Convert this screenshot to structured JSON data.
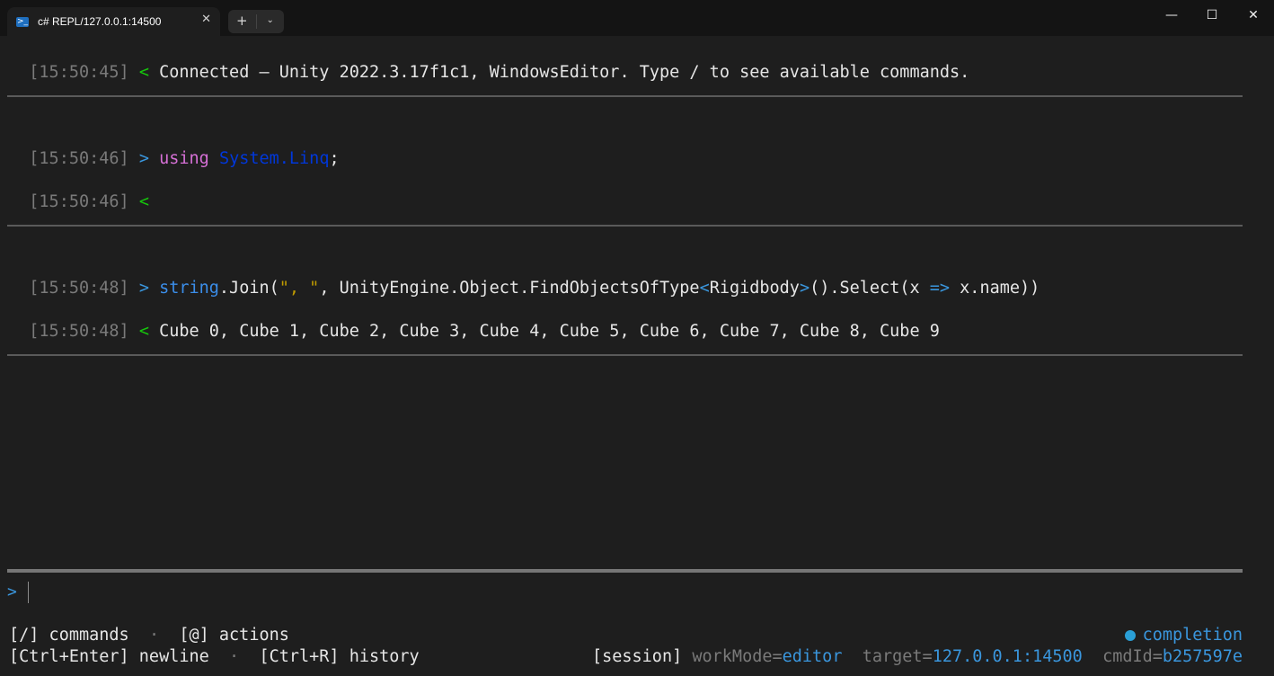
{
  "window": {
    "tab_title": "c# REPL/127.0.0.1:14500",
    "tab_icon": "powershell-icon",
    "new_tab_label": "+",
    "dropdown_label": "⌄",
    "close_tab_label": "✕",
    "minimize_label": "—",
    "maximize_label": "☐",
    "close_label": "✕"
  },
  "console": {
    "connected": {
      "ts": "[15:50:45]",
      "dir": "<",
      "text": "Connected — Unity 2022.3.17f1c1, WindowsEditor. Type / to see available commands."
    },
    "cmd1": {
      "ts": "[15:50:46]",
      "dir": ">",
      "kw": "using",
      "ns": "System.Linq",
      "semi": ";"
    },
    "out1": {
      "ts": "[15:50:46]",
      "dir": "<",
      "text": ""
    },
    "cmd2": {
      "ts": "[15:50:48]",
      "dir": ">",
      "t1": "string",
      "t2": ".Join(",
      "t3": "\", \"",
      "t4": ", UnityEngine.Object.FindObjectsOfType",
      "t5": "<",
      "t6": "Rigidbody",
      "t7": ">",
      "t8": "().Select(x ",
      "t9": "=>",
      "t10": " x.name))"
    },
    "out2": {
      "ts": "[15:50:48]",
      "dir": "<",
      "text": "Cube 0, Cube 1, Cube 2, Cube 3, Cube 4, Cube 5, Cube 6, Cube 7, Cube 8, Cube 9"
    }
  },
  "input": {
    "prompt": ">"
  },
  "footer": {
    "commands": "[/] commands",
    "sep1": "·",
    "actions": "[@] actions",
    "newline": "[Ctrl+Enter] newline",
    "sep2": "·",
    "history": "[Ctrl+R] history",
    "completion": "completion",
    "session": "[session]",
    "workmode_key": "workMode=",
    "workmode_val": "editor",
    "target_key": "target=",
    "target_val": "127.0.0.1:14500",
    "cmdid_key": "cmdId=",
    "cmdid_val": "b257597e"
  }
}
